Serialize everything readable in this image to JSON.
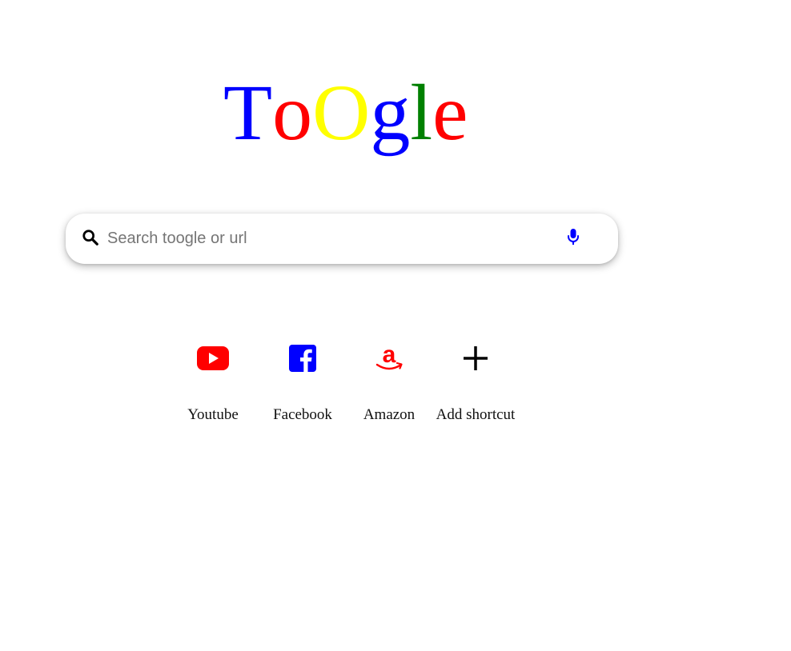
{
  "logo": {
    "letters": [
      {
        "char": "T",
        "color": "#0000ff"
      },
      {
        "char": "o",
        "color": "#ff0000"
      },
      {
        "char": "O",
        "color": "#ffff00"
      },
      {
        "char": "g",
        "color": "#0000ff"
      },
      {
        "char": "l",
        "color": "#008000"
      },
      {
        "char": "e",
        "color": "#ff0000"
      }
    ]
  },
  "search": {
    "placeholder": "Search toogle or url",
    "value": "",
    "search_icon": "search-icon",
    "mic_icon": "microphone-icon",
    "mic_color": "#0000ff"
  },
  "shortcuts": [
    {
      "label": "Youtube",
      "icon": "youtube-icon",
      "color": "#ff0000"
    },
    {
      "label": "Facebook",
      "icon": "facebook-icon",
      "color": "#0000ff"
    },
    {
      "label": "Amazon",
      "icon": "amazon-icon",
      "color": "#ff0000"
    },
    {
      "label": "Add shortcut",
      "icon": "plus-icon",
      "color": "#000000"
    }
  ]
}
